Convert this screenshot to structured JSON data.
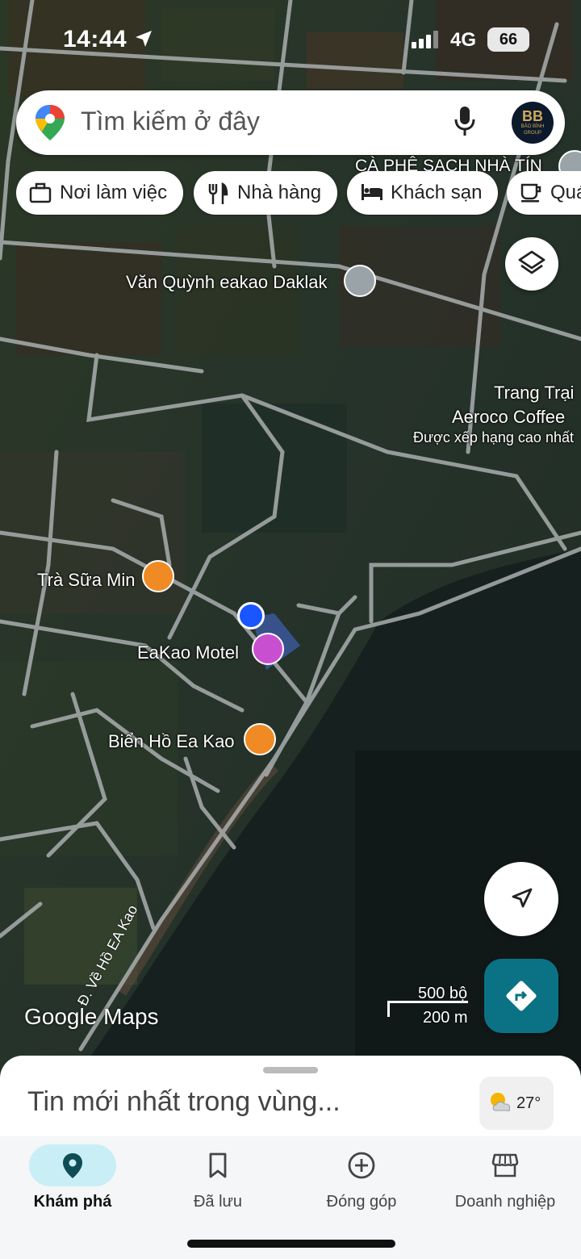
{
  "status_bar": {
    "time": "14:44",
    "network": "4G",
    "battery": "66"
  },
  "search": {
    "placeholder": "Tìm kiếm ở đây",
    "avatar_text": "BẢO BÌNH GROUP",
    "avatar_monogram": "BB"
  },
  "chips": [
    {
      "label": "Nơi làm việc",
      "icon": "briefcase-icon"
    },
    {
      "label": "Nhà hàng",
      "icon": "fork-knife-icon"
    },
    {
      "label": "Khách sạn",
      "icon": "bed-icon"
    },
    {
      "label": "Quá",
      "icon": "coffee-cup-icon"
    }
  ],
  "map": {
    "places": {
      "ca_phe": "CÀ PHÊ SẠCH NHÀ TÍN",
      "van_quynh": "Văn Quỳnh eakao Daklak",
      "trang_trai_line1": "Trang Trại",
      "trang_trai_line2": "Aeroco Coffee",
      "trang_trai_note": "Được xếp hạng cao nhất",
      "tra_sua": "Trà Sữa Min",
      "motel": "EaKao Motel",
      "bien_ho": "Biển Hồ Ea Kao",
      "road": "Đ. Về Hồ EA Kao"
    },
    "scale": {
      "feet": "500 bộ",
      "meters": "200 m"
    },
    "attribution": "Google Maps"
  },
  "bottom_sheet": {
    "title": "Tin mới nhất trong vùng...",
    "temperature": "27°"
  },
  "nav": [
    {
      "label": "Khám phá",
      "icon": "location-pin-icon",
      "active": true
    },
    {
      "label": "Đã lưu",
      "icon": "bookmark-icon",
      "active": false
    },
    {
      "label": "Đóng góp",
      "icon": "add-circle-icon",
      "active": false
    },
    {
      "label": "Doanh nghiệp",
      "icon": "storefront-icon",
      "active": false
    }
  ],
  "colors": {
    "accent": "#0b7285",
    "active_pill": "#c9eef5",
    "user_dot": "#1a56ff",
    "hotel_poi": "#c94fd1",
    "food_poi": "#f08a24"
  }
}
